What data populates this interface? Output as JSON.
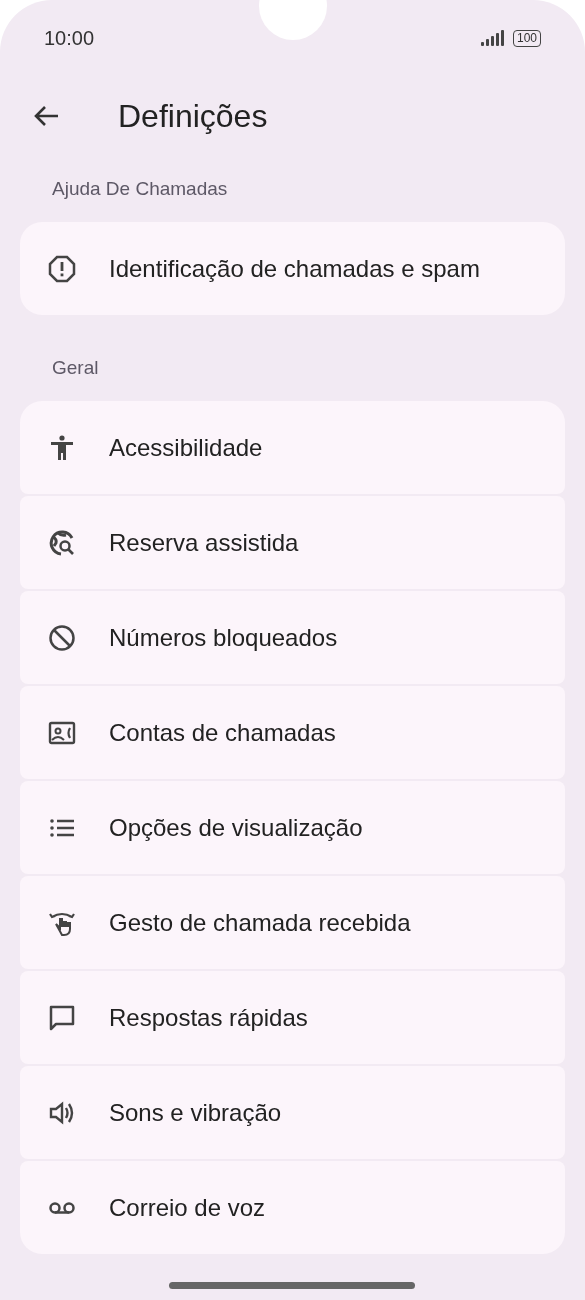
{
  "status_bar": {
    "time": "10:00",
    "battery": "100"
  },
  "app_bar": {
    "title": "Definições"
  },
  "sections": [
    {
      "header": "Ajuda De Chamadas",
      "items": [
        {
          "label": "Identificação de chamadas e spam"
        }
      ]
    },
    {
      "header": "Geral",
      "items": [
        {
          "label": "Acessibilidade"
        },
        {
          "label": "Reserva assistida"
        },
        {
          "label": "Números bloqueados"
        },
        {
          "label": "Contas de chamadas"
        },
        {
          "label": "Opções de visualização"
        },
        {
          "label": "Gesto de chamada recebida"
        },
        {
          "label": "Respostas rápidas"
        },
        {
          "label": "Sons e vibração"
        },
        {
          "label": "Correio de voz"
        }
      ]
    }
  ]
}
